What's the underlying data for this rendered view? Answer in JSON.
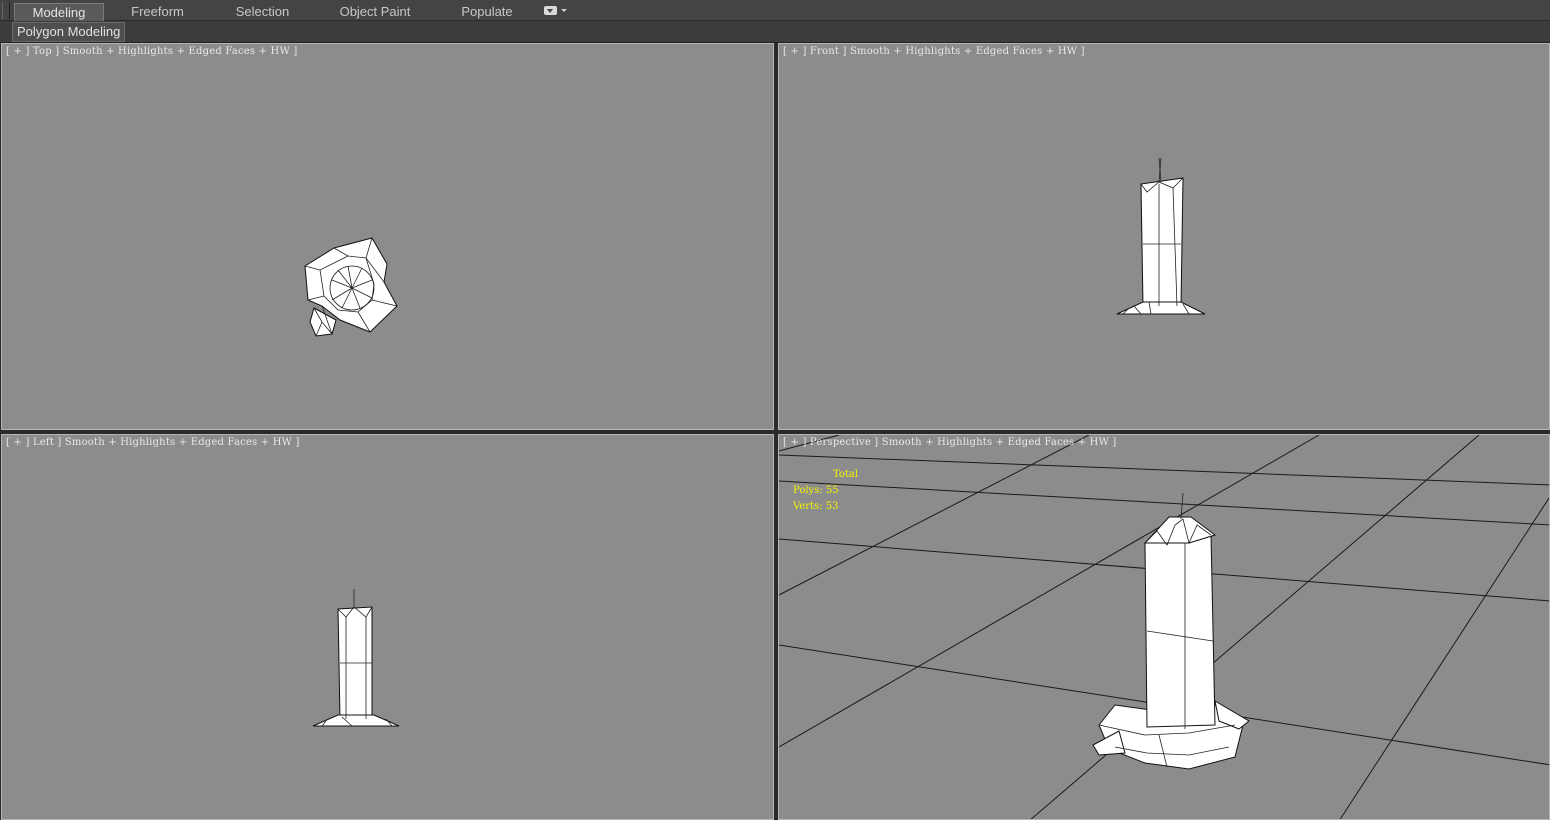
{
  "ribbon": {
    "tabs": [
      "Modeling",
      "Freeform",
      "Selection",
      "Object Paint",
      "Populate"
    ],
    "active_tab": "Modeling",
    "panel_label": "Polygon Modeling"
  },
  "viewports": {
    "top": {
      "label": "[ + ] Top ] Smooth + Highlights + Edged Faces + HW ]"
    },
    "front": {
      "label": "[ + ] Front ] Smooth + Highlights + Edged Faces + HW ]"
    },
    "left": {
      "label": "[ + ] Left ] Smooth + Highlights + Edged Faces + HW ]"
    },
    "perspective": {
      "label": "[ + ] Perspective ] Smooth + Highlights + Edged Faces + HW ]",
      "stats": {
        "total_label": "Total",
        "polys": "Polys: 55",
        "verts": "Verts: 53"
      }
    }
  },
  "colors": {
    "viewport_bg": "#8c8c8c",
    "stats_text": "#f4f400",
    "ui_dark": "#444444"
  }
}
